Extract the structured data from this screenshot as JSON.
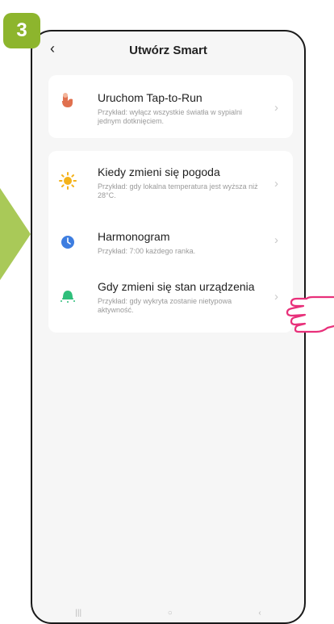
{
  "step": {
    "number": "3"
  },
  "header": {
    "title": "Utwórz Smart",
    "back_glyph": "‹"
  },
  "cards": [
    {
      "items": [
        {
          "icon": "tap-hand-icon",
          "title": "Uruchom Tap-to-Run",
          "subtitle": "Przykład: wyłącz wszystkie światła w sypialni jednym dotknięciem."
        }
      ]
    },
    {
      "items": [
        {
          "icon": "sun-icon",
          "title": "Kiedy zmieni się pogoda",
          "subtitle": "Przykład: gdy lokalna temperatura jest wyższa niż 28°C."
        },
        {
          "icon": "clock-icon",
          "title": "Harmonogram",
          "subtitle": "Przykład: 7:00 każdego ranka."
        },
        {
          "icon": "device-icon",
          "title": "Gdy zmieni się stan urządzenia",
          "subtitle": "Przykład: gdy wykryta zostanie nietypowa aktywność."
        }
      ]
    }
  ],
  "chevron_glyph": "›",
  "colors": {
    "badge": "#8db52d",
    "arrow": "#a9c958",
    "tap_icon": "#e0704e",
    "sun_icon": "#f4b21a",
    "clock_icon": "#3d7de0",
    "device_icon": "#2fbf7b",
    "hand_outline": "#e8307a"
  }
}
